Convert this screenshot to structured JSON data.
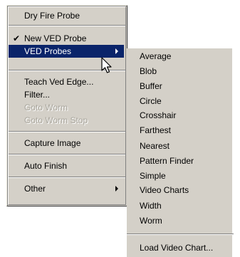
{
  "menu": {
    "items": [
      {
        "label": "Dry Fire Probe",
        "checked": false,
        "submenu": false,
        "disabled": false,
        "selected": false
      },
      {
        "label": "New VED Probe",
        "checked": true,
        "submenu": false,
        "disabled": false,
        "selected": false
      },
      {
        "label": "VED Probes",
        "checked": false,
        "submenu": true,
        "disabled": false,
        "selected": true
      },
      {
        "label": "Teach Ved Edge...",
        "checked": false,
        "submenu": false,
        "disabled": false,
        "selected": false
      },
      {
        "label": "Filter...",
        "checked": false,
        "submenu": false,
        "disabled": false,
        "selected": false
      },
      {
        "label": "Goto Worm",
        "checked": false,
        "submenu": false,
        "disabled": true,
        "selected": false
      },
      {
        "label": "Goto Worm Stop",
        "checked": false,
        "submenu": false,
        "disabled": true,
        "selected": false
      },
      {
        "label": "Capture Image",
        "checked": false,
        "submenu": false,
        "disabled": false,
        "selected": false
      },
      {
        "label": "Auto Finish",
        "checked": false,
        "submenu": false,
        "disabled": false,
        "selected": false
      },
      {
        "label": "Other",
        "checked": false,
        "submenu": true,
        "disabled": false,
        "selected": false
      }
    ],
    "check_mark": "✔"
  },
  "submenu": {
    "items": [
      "Average",
      "Blob",
      "Buffer",
      "Circle",
      "Crosshair",
      "Farthest",
      "Nearest",
      "Pattern Finder",
      "Simple",
      "Video Charts",
      "Width",
      "Worm"
    ],
    "footer_item": "Load Video Chart..."
  },
  "colors": {
    "menu_background": "#d4d0c8",
    "highlight": "#0a246a",
    "highlight_text": "#ffffff",
    "disabled_text": "#a9a69d"
  }
}
